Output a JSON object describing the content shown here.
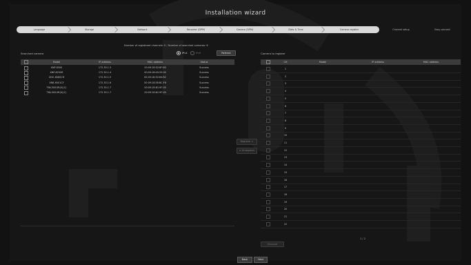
{
  "window": {
    "title": "Installation wizard"
  },
  "steps": [
    {
      "label": "Language",
      "state": "done"
    },
    {
      "label": "Storage",
      "state": "done"
    },
    {
      "label": "Network",
      "state": "done"
    },
    {
      "label": "Recorder (DPM)",
      "state": "done"
    },
    {
      "label": "Camera (DPM)",
      "state": "done"
    },
    {
      "label": "Date & Time",
      "state": "done"
    },
    {
      "label": "Camera register",
      "state": "current"
    },
    {
      "label": "Channel setup",
      "state": "pending"
    },
    {
      "label": "Easy connect",
      "state": "pending"
    }
  ],
  "search": {
    "registered_info": "Number of registered channels: 0 / Number of searched cameras: 6",
    "ipv4_label": "IPv4",
    "ipv6_label": "IPv6",
    "refresh_label": "Refresh",
    "section_label": "Searched camera"
  },
  "searched_table": {
    "headers": [
      "Model",
      "IP address",
      "MAC address",
      "Status"
    ],
    "rows": [
      [
        "XNP-8300",
        "172.30.1.3",
        "00:09:18:52:8F:0B",
        "Success"
      ],
      [
        "XNP-8250R",
        "172.30.1.4",
        "00:09:18:40:33:00",
        "Success"
      ],
      [
        "XNO-8080CR",
        "172.30.1.5",
        "00:09:18:50:84:B2",
        "Success"
      ],
      [
        "XNB-6001CF",
        "172.30.1.6",
        "00:09:18:58:BC:F6",
        "Success"
      ],
      [
        "TNV-8010R(X)(C)",
        "172.30.1.7",
        "00:09:18:61:9F:1B",
        "Success"
      ],
      [
        "TNV-8010R(X)(C)",
        "172.30.1.7",
        "00:09:18:61:9F:1B",
        "Success"
      ]
    ]
  },
  "register": {
    "section_label": "Camera to register",
    "register_btn": "Register >",
    "unregister_btn": "< Unregister",
    "headers": [
      "CH",
      "Model",
      "IP address",
      "MAC address"
    ],
    "channels": [
      "1",
      "2",
      "3",
      "4",
      "5",
      "6",
      "7",
      "8",
      "9",
      "10",
      "11",
      "12",
      "13",
      "14",
      "15",
      "16",
      "17",
      "18",
      "19",
      "20",
      "21",
      "22"
    ],
    "page_indicator": "1 / 2",
    "page_bottom_btn": "Channel"
  },
  "footer": {
    "back_label": "Back",
    "next_label": "Next"
  },
  "colors": {
    "background": "#161616",
    "step_done_bg": "#d9d9d9",
    "table_header": "#3c3c3c"
  }
}
